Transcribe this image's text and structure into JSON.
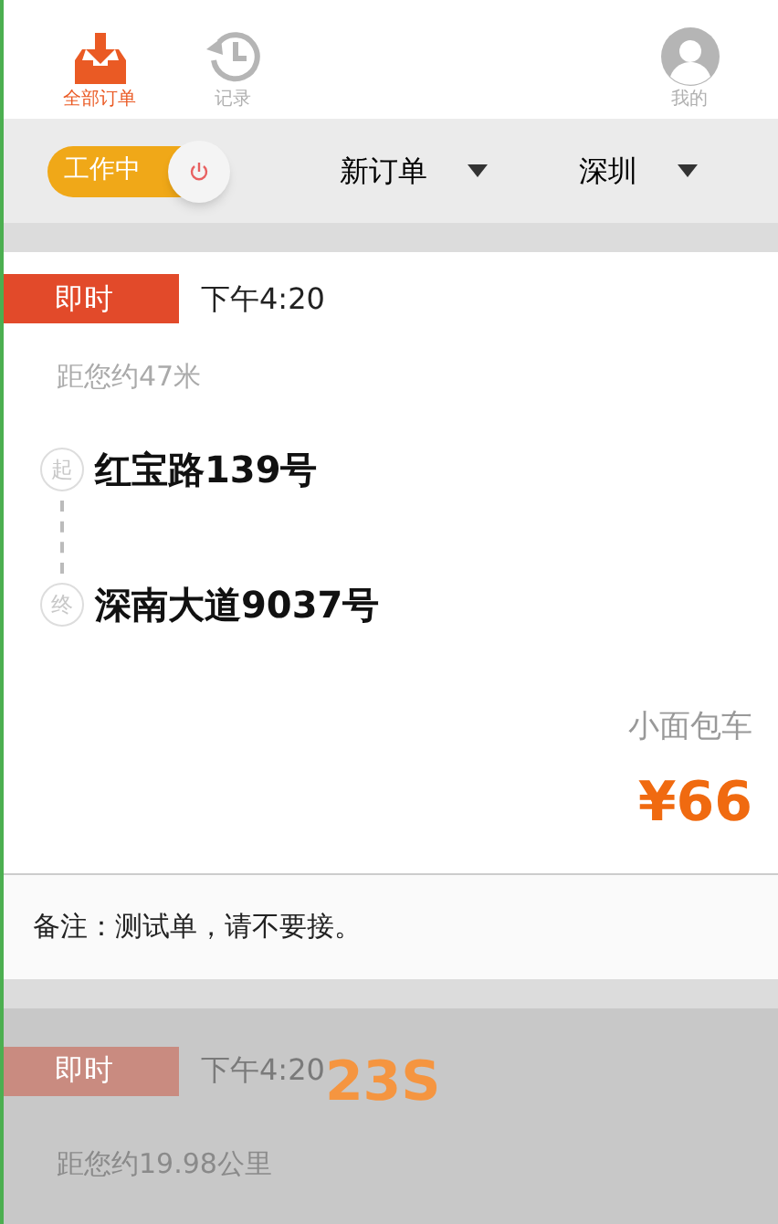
{
  "tabs": [
    {
      "label": "全部订单",
      "kind": "inbox",
      "selected": true
    },
    {
      "label": "记录",
      "kind": "history",
      "selected": false
    },
    {
      "label": "我的",
      "kind": "user",
      "selected": false
    }
  ],
  "filter_bar": {
    "work_switch": {
      "label": "工作中",
      "on": true
    },
    "dropdowns": [
      {
        "label": "新订单"
      },
      {
        "label": "深圳"
      }
    ]
  },
  "orders": [
    {
      "tag": "即时",
      "time": "下午4:20",
      "distance": "距您约47米",
      "start_mark": "起",
      "start": "红宝路139号",
      "end_mark": "终",
      "end": "深南大道9037号",
      "vehicle": "小面包车",
      "price": "¥66",
      "note": "备注：测试单，请不要接。",
      "dimmed": false
    },
    {
      "tag": "即时",
      "time": "下午4:20",
      "distance": "距您约19.98公里",
      "countdown": "23S",
      "dimmed": true
    }
  ]
}
